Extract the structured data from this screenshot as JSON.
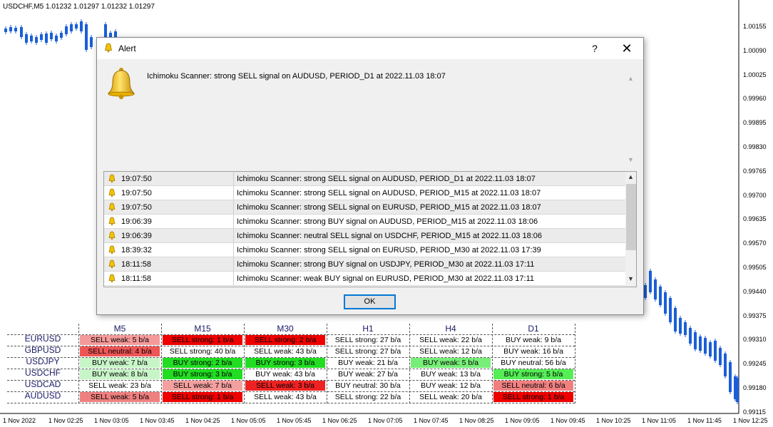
{
  "chart": {
    "title": "USDCHF,M5  1.01232 1.01297 1.01232 1.01297",
    "colors": {
      "candle": "#1a5ed9",
      "grid_dots": "#000000"
    },
    "price_labels": [
      "1.00155",
      "1.00090",
      "1.00025",
      "0.99960",
      "0.99895",
      "0.99830",
      "0.99765",
      "0.99700",
      "0.99635",
      "0.99570",
      "0.99505",
      "0.99440",
      "0.99375",
      "0.99310",
      "0.99245",
      "0.99180",
      "0.99115"
    ],
    "time_labels": [
      "1 Nov 2022",
      "1 Nov 02:25",
      "1 Nov 03:05",
      "1 Nov 03:45",
      "1 Nov 04:25",
      "1 Nov 05:05",
      "1 Nov 05:45",
      "1 Nov 06:25",
      "1 Nov 07:05",
      "1 Nov 07:45",
      "1 Nov 08:25",
      "1 Nov 09:05",
      "1 Nov 09:45",
      "1 Nov 10:25",
      "1 Nov 11:05",
      "1 Nov 11:45",
      "1 Nov 12:25"
    ]
  },
  "scanner": {
    "timeframes": [
      "M5",
      "M15",
      "M30",
      "H1",
      "H4",
      "D1"
    ],
    "symbols": [
      "EURUSD",
      "GBPUSD",
      "USDJPY",
      "USDCHF",
      "USDCAD",
      "AUDUSD"
    ],
    "cells": [
      [
        {
          "text": "SELL weak: 5 b/a",
          "bg": "#f59a9a"
        },
        {
          "text": "SELL strong: 1 b/a",
          "bg": "#ee0000"
        },
        {
          "text": "SELL strong: 2 b/a",
          "bg": "#ee0000"
        },
        {
          "text": "SELL strong: 27 b/a",
          "bg": "#ffffff"
        },
        {
          "text": "SELL weak: 22 b/a",
          "bg": "#ffffff"
        },
        {
          "text": "BUY weak: 9 b/a",
          "bg": "#ffffff"
        }
      ],
      [
        {
          "text": "SELL neutral: 4 b/a",
          "bg": "#ee5555"
        },
        {
          "text": "SELL strong: 40 b/a",
          "bg": "#ffffff"
        },
        {
          "text": "SELL weak: 43 b/a",
          "bg": "#ffffff"
        },
        {
          "text": "SELL strong: 27 b/a",
          "bg": "#ffffff"
        },
        {
          "text": "SELL weak: 12 b/a",
          "bg": "#ffffff"
        },
        {
          "text": "BUY weak: 16 b/a",
          "bg": "#ffffff"
        }
      ],
      [
        {
          "text": "BUY weak: 7 b/a",
          "bg": "#c8f5c8"
        },
        {
          "text": "BUY strong: 2 b/a",
          "bg": "#22dd22"
        },
        {
          "text": "BUY strong: 3 b/a",
          "bg": "#22dd22"
        },
        {
          "text": "BUY weak: 21 b/a",
          "bg": "#ffffff"
        },
        {
          "text": "BUY weak: 5 b/a",
          "bg": "#77ee77"
        },
        {
          "text": "BUY neutral: 56 b/a",
          "bg": "#ffffff"
        }
      ],
      [
        {
          "text": "BUY weak: 8 b/a",
          "bg": "#c8f5c8"
        },
        {
          "text": "BUY strong: 3 b/a",
          "bg": "#22dd22"
        },
        {
          "text": "BUY weak: 43 b/a",
          "bg": "#ffffff"
        },
        {
          "text": "BUY weak: 27 b/a",
          "bg": "#ffffff"
        },
        {
          "text": "BUY weak: 13 b/a",
          "bg": "#ffffff"
        },
        {
          "text": "BUY strong: 5 b/a",
          "bg": "#55ee55"
        }
      ],
      [
        {
          "text": "SELL weak: 23 b/a",
          "bg": "#ffffff"
        },
        {
          "text": "SELL weak: 7 b/a",
          "bg": "#f5a0a0"
        },
        {
          "text": "SELL weak: 3 b/a",
          "bg": "#ee2222"
        },
        {
          "text": "BUY neutral: 30 b/a",
          "bg": "#ffffff"
        },
        {
          "text": "BUY weak: 12 b/a",
          "bg": "#ffffff"
        },
        {
          "text": "SELL neutral: 6 b/a",
          "bg": "#f08080"
        }
      ],
      [
        {
          "text": "SELL weak: 5 b/a",
          "bg": "#f08080"
        },
        {
          "text": "SELL strong: 1 b/a",
          "bg": "#ee0000"
        },
        {
          "text": "SELL weak: 43 b/a",
          "bg": "#ffffff"
        },
        {
          "text": "SELL strong: 22 b/a",
          "bg": "#ffffff"
        },
        {
          "text": "SELL weak: 20 b/a",
          "bg": "#ffffff"
        },
        {
          "text": "SELL strong: 1 b/a",
          "bg": "#ee0000"
        }
      ]
    ]
  },
  "dialog": {
    "title": "Alert",
    "help_label": "?",
    "close_label": "✕",
    "message": "Ichimoku Scanner: strong SELL signal on AUDUSD, PERIOD_D1 at 2022.11.03 18:07",
    "ok_label": "OK",
    "log": [
      {
        "time": "19:07:50",
        "message": "Ichimoku Scanner: strong SELL signal on AUDUSD, PERIOD_D1 at 2022.11.03 18:07"
      },
      {
        "time": "19:07:50",
        "message": "Ichimoku Scanner: strong SELL signal on AUDUSD, PERIOD_M15 at 2022.11.03 18:07"
      },
      {
        "time": "19:07:50",
        "message": "Ichimoku Scanner: strong SELL signal on EURUSD, PERIOD_M15 at 2022.11.03 18:07"
      },
      {
        "time": "19:06:39",
        "message": "Ichimoku Scanner: strong BUY signal on AUDUSD, PERIOD_M15 at 2022.11.03 18:06"
      },
      {
        "time": "19:06:39",
        "message": "Ichimoku Scanner: neutral SELL signal on USDCHF, PERIOD_M15 at 2022.11.03 18:06"
      },
      {
        "time": "18:39:32",
        "message": "Ichimoku Scanner: strong SELL signal on EURUSD, PERIOD_M30 at 2022.11.03 17:39"
      },
      {
        "time": "18:11:58",
        "message": "Ichimoku Scanner: strong BUY signal on USDJPY, PERIOD_M30 at 2022.11.03 17:11"
      },
      {
        "time": "18:11:58",
        "message": "Ichimoku Scanner: weak BUY signal on EURUSD, PERIOD_M30 at 2022.11.03 17:11"
      }
    ]
  }
}
